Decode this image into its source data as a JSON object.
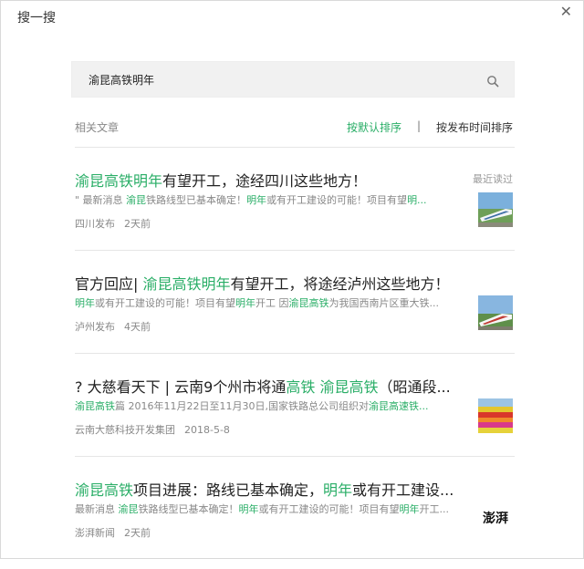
{
  "window": {
    "title": "搜一搜",
    "close": "✕"
  },
  "search": {
    "value": "渝昆高铁明年",
    "icon": "search-icon"
  },
  "sort": {
    "related_label": "相关文章",
    "default": "按默认排序",
    "separator": "|",
    "by_time": "按发布时间排序"
  },
  "results": [
    {
      "title": [
        {
          "t": "渝昆高铁明年",
          "hl": true
        },
        {
          "t": "有望开工，途经四川这些地方！",
          "hl": false
        }
      ],
      "snippet": [
        {
          "t": "\"    最新消息 ",
          "hl": false
        },
        {
          "t": "渝昆",
          "hl": true
        },
        {
          "t": "铁路线型已基本确定！",
          "hl": false
        },
        {
          "t": "明年",
          "hl": true
        },
        {
          "t": "或有开工建设的可能！项目有望",
          "hl": false
        },
        {
          "t": "明...",
          "hl": true
        }
      ],
      "source": "四川发布",
      "time": "2天前",
      "badge": "最近读过",
      "thumb": "high-speed-train-thumbnail"
    },
    {
      "title": [
        {
          "t": "官方回应| ",
          "hl": false
        },
        {
          "t": "渝昆高铁明年",
          "hl": true
        },
        {
          "t": "有望开工，将途经泸州这些地方！",
          "hl": false
        }
      ],
      "snippet": [
        {
          "t": "明年",
          "hl": true
        },
        {
          "t": "或有开工建设的可能！项目有望",
          "hl": false
        },
        {
          "t": "明年",
          "hl": true
        },
        {
          "t": "开工 因",
          "hl": false
        },
        {
          "t": "渝昆高铁",
          "hl": true
        },
        {
          "t": "为我国西南片区重大铁...",
          "hl": false
        }
      ],
      "source": "泸州发布",
      "time": "4天前",
      "badge": "",
      "thumb": "high-speed-train-thumbnail"
    },
    {
      "title": [
        {
          "t": "? 大慈看天下 | 云南9个州市将通",
          "hl": false
        },
        {
          "t": "高铁",
          "hl": true
        },
        {
          "t": " ",
          "hl": false
        },
        {
          "t": "渝昆高铁",
          "hl": true
        },
        {
          "t": "（昭通段...",
          "hl": false
        }
      ],
      "snippet": [
        {
          "t": "渝昆高铁",
          "hl": true
        },
        {
          "t": "篇 2016年11月22日至11月30日,国家铁路总公司组织对",
          "hl": false
        },
        {
          "t": "渝昆高速铁...",
          "hl": true
        }
      ],
      "source": "云南大慈科技开发集团",
      "time": "2018-5-8",
      "badge": "",
      "thumb": "flower-field-thumbnail"
    },
    {
      "title": [
        {
          "t": "渝昆高铁",
          "hl": true
        },
        {
          "t": "项目进展：路线已基本确定，",
          "hl": false
        },
        {
          "t": "明年",
          "hl": true
        },
        {
          "t": "或有开工建设...",
          "hl": false
        }
      ],
      "snippet": [
        {
          "t": "最新消息 ",
          "hl": false
        },
        {
          "t": "渝昆",
          "hl": true
        },
        {
          "t": "铁路线型已基本确定！",
          "hl": false
        },
        {
          "t": "明年",
          "hl": true
        },
        {
          "t": "或有开工建设的可能！项目有望",
          "hl": false
        },
        {
          "t": "明年",
          "hl": true
        },
        {
          "t": "开工...",
          "hl": false
        }
      ],
      "source": "澎湃新闻",
      "time": "2天前",
      "badge": "",
      "thumb": "pengpai-logo-thumbnail",
      "thumb_text": "澎湃"
    }
  ],
  "colors": {
    "accent": "#2aae67",
    "muted": "#888888"
  }
}
